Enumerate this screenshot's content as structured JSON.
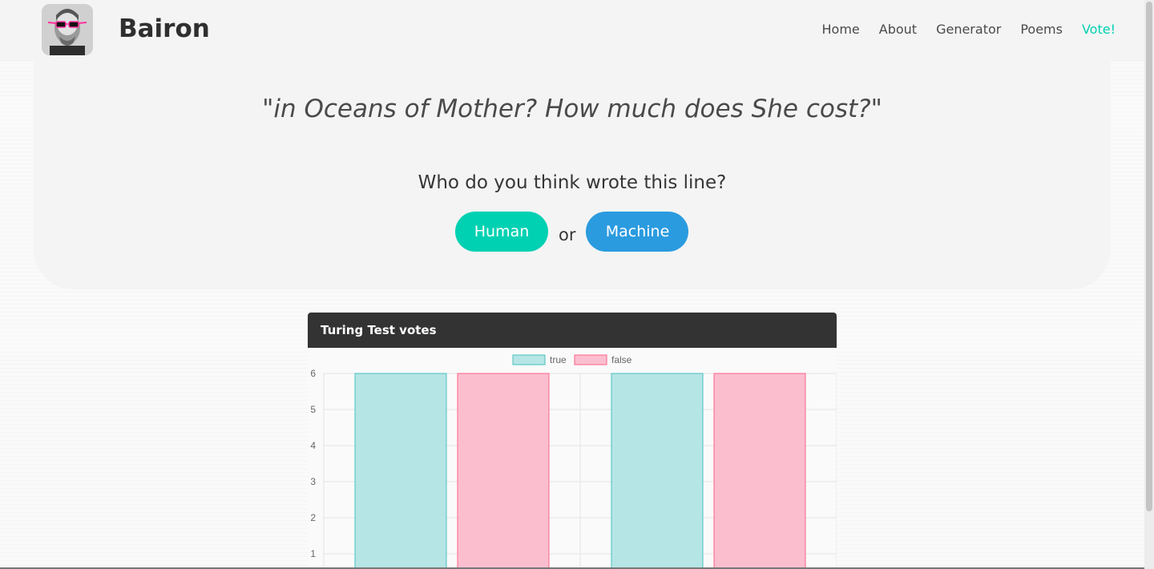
{
  "brand": {
    "name": "Bairon"
  },
  "nav": {
    "links": [
      {
        "label": "Home"
      },
      {
        "label": "About"
      },
      {
        "label": "Generator"
      },
      {
        "label": "Poems"
      },
      {
        "label": "Vote!",
        "active": true
      }
    ]
  },
  "hero": {
    "quote": "\"in Oceans of Mother? How much does She cost?\"",
    "question": "Who do you think wrote this line?",
    "human_label": "Human",
    "or_label": "or",
    "machine_label": "Machine"
  },
  "card": {
    "title": "Turing Test votes"
  },
  "colors": {
    "accent": "#00d1b2",
    "machine_button": "#2b9bdf",
    "true_fill": "#b6e5e5",
    "true_stroke": "#4bc0c0",
    "false_fill": "#fbbecf",
    "false_stroke": "#ff6384"
  },
  "chart_data": {
    "type": "bar",
    "title": "",
    "categories": [
      "",
      ""
    ],
    "series": [
      {
        "name": "true",
        "values": [
          6,
          6
        ]
      },
      {
        "name": "false",
        "values": [
          6,
          6
        ]
      }
    ],
    "yticks": [
      1,
      2,
      3,
      4,
      5,
      6
    ],
    "ylim": [
      0,
      6
    ],
    "grid": true,
    "legend": "top"
  }
}
